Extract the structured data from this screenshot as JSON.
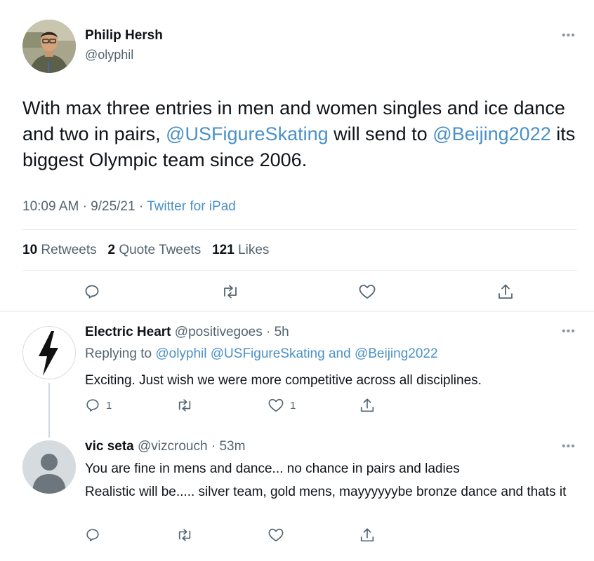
{
  "main_tweet": {
    "author_name": "Philip Hersh",
    "author_handle": "@olyphil",
    "text_1": "With max three entries in men and women singles and ice dance and two in pairs, ",
    "mention_1": "@USFigureSkating",
    "text_2": " will send to ",
    "mention_2": "@Beijing2022",
    "text_3": " its biggest Olympic team since 2006.",
    "time": "10:09 AM",
    "date": "9/25/21",
    "source": "Twitter for iPad",
    "retweets_count": "10",
    "retweets_label": "Retweets",
    "quotes_count": "2",
    "quotes_label": "Quote Tweets",
    "likes_count": "121",
    "likes_label": "Likes"
  },
  "replies": [
    {
      "author_name": "Electric Heart",
      "author_handle": "@positivegoes",
      "age": "5h",
      "replying_prefix": "Replying to ",
      "replying_mentions": "@olyphil @USFigureSkating and @Beijing2022",
      "text": "Exciting. Just wish we were more competitive across all disciplines.",
      "reply_count": "1",
      "like_count": "1"
    },
    {
      "author_name": "vic seta",
      "author_handle": "@vizcrouch",
      "age": "53m",
      "text_line_1": "You are fine in mens and dance... no chance in pairs and ladies",
      "text_line_2": "Realistic will be..... silver team, gold mens, mayyyyyybe bronze dance and thats it"
    }
  ],
  "icons": {
    "more": "more-dots-icon",
    "reply": "reply-icon",
    "retweet": "retweet-icon",
    "like": "heart-icon",
    "share": "share-icon"
  },
  "colors": {
    "link": "#4a90c8",
    "muted": "#536471",
    "divider": "#e6ecf0"
  }
}
